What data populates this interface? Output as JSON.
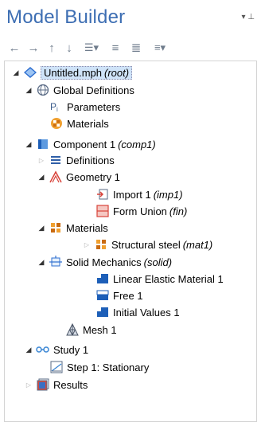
{
  "panel": {
    "title": "Model Builder",
    "pin_glyph": "▾ ⊥"
  },
  "toolbar": {
    "items": [
      {
        "name": "back-arrow-icon",
        "glyph": "←"
      },
      {
        "name": "forward-arrow-icon",
        "glyph": "→"
      },
      {
        "name": "move-up-icon",
        "glyph": "↑"
      },
      {
        "name": "move-down-icon",
        "glyph": "↓"
      },
      {
        "name": "show-options-icon",
        "glyph": "☰▾"
      },
      {
        "name": "expand-icon",
        "glyph": "≡"
      },
      {
        "name": "collapse-icon",
        "glyph": "≣"
      },
      {
        "name": "more-icon",
        "glyph": "≡▾"
      }
    ]
  },
  "tree": {
    "root": {
      "label": "Untitled.mph",
      "tag": "(root)"
    },
    "global_definitions": {
      "label": "Global Definitions"
    },
    "parameters": {
      "label": "Parameters"
    },
    "global_materials": {
      "label": "Materials"
    },
    "component": {
      "label": "Component 1",
      "tag": "(comp1)"
    },
    "definitions": {
      "label": "Definitions"
    },
    "geometry": {
      "label": "Geometry 1"
    },
    "import": {
      "label": "Import 1",
      "tag": "(imp1)"
    },
    "form_union": {
      "label": "Form Union",
      "tag": "(fin)"
    },
    "materials": {
      "label": "Materials"
    },
    "structural_steel": {
      "label": "Structural steel",
      "tag": "(mat1)"
    },
    "solid_mechanics": {
      "label": "Solid Mechanics",
      "tag": "(solid)"
    },
    "linear_elastic": {
      "label": "Linear Elastic Material 1"
    },
    "free": {
      "label": "Free 1"
    },
    "initial_values": {
      "label": "Initial Values 1"
    },
    "mesh": {
      "label": "Mesh 1"
    },
    "study": {
      "label": "Study 1"
    },
    "step": {
      "label": "Step 1: Stationary"
    },
    "results": {
      "label": "Results"
    }
  },
  "colors": {
    "title": "#3d6eb3",
    "selection": "#cfe3f8"
  }
}
